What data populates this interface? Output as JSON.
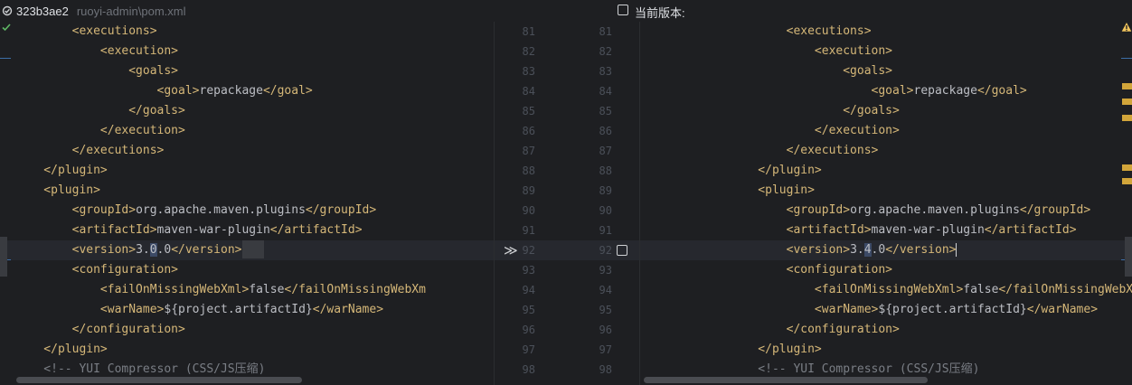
{
  "header": {
    "revision": "323b3ae2",
    "file_path": "ruoyi-admin\\pom.xml",
    "current_version_label": "当前版本:"
  },
  "icons": {
    "commit": "commit-check-icon",
    "status_ok": "checkmark-icon",
    "warning": "warning-icon",
    "apply_change": "apply-change-arrows-icon",
    "accept_checkbox": "checkbox-icon"
  },
  "colors": {
    "background": "#1e1f22",
    "tag": "#d5b778",
    "text": "#bcbec4",
    "comment": "#7a7e85",
    "changed_highlight": "#3c4a66",
    "marker": "#d2a53a"
  },
  "left_lines": [
    [
      [
        "tg",
        "        <executions>"
      ]
    ],
    [
      [
        "tg",
        "            <execution>"
      ]
    ],
    [
      [
        "tg",
        "                <goals>"
      ]
    ],
    [
      [
        "tg",
        "                    <goal>"
      ],
      [
        "tx",
        "repackage"
      ],
      [
        "tg",
        "</goal>"
      ]
    ],
    [
      [
        "tg",
        "                </goals>"
      ]
    ],
    [
      [
        "tg",
        "            </execution>"
      ]
    ],
    [
      [
        "tg",
        "        </executions>"
      ]
    ],
    [
      [
        "tg",
        "    </plugin>"
      ]
    ],
    [
      [
        "tg",
        "    <plugin>"
      ]
    ],
    [
      [
        "tg",
        "        <groupId>"
      ],
      [
        "tx",
        "org.apache.maven.plugins"
      ],
      [
        "tg",
        "</groupId>"
      ]
    ],
    [
      [
        "tg",
        "        <artifactId>"
      ],
      [
        "tx",
        "maven-war-plugin"
      ],
      [
        "tg",
        "</artifactId>"
      ]
    ],
    [
      [
        "tg",
        "        <version>"
      ],
      [
        "tx",
        "3."
      ],
      [
        "chg",
        "0"
      ],
      [
        "tx",
        ".0"
      ],
      [
        "tg",
        "</version>"
      ]
    ],
    [
      [
        "tg",
        "        <configuration>"
      ]
    ],
    [
      [
        "tg",
        "            <failOnMissingWebXml>"
      ],
      [
        "tx",
        "false"
      ],
      [
        "tg",
        "</failOnMissingWebXm"
      ]
    ],
    [
      [
        "tg",
        "            <warName>"
      ],
      [
        "tx",
        "${project.artifactId}"
      ],
      [
        "tg",
        "</warName>"
      ]
    ],
    [
      [
        "tg",
        "        </configuration>"
      ]
    ],
    [
      [
        "tg",
        "    </plugin>"
      ]
    ],
    [
      [
        "cm",
        "    <!-- YUI Compressor (CSS/JS压缩)"
      ]
    ]
  ],
  "right_lines": [
    [
      [
        "tg",
        "        <executions>"
      ]
    ],
    [
      [
        "tg",
        "            <execution>"
      ]
    ],
    [
      [
        "tg",
        "                <goals>"
      ]
    ],
    [
      [
        "tg",
        "                    <goal>"
      ],
      [
        "tx",
        "repackage"
      ],
      [
        "tg",
        "</goal>"
      ]
    ],
    [
      [
        "tg",
        "                </goals>"
      ]
    ],
    [
      [
        "tg",
        "            </execution>"
      ]
    ],
    [
      [
        "tg",
        "        </executions>"
      ]
    ],
    [
      [
        "tg",
        "    </plugin>"
      ]
    ],
    [
      [
        "tg",
        "    <plugin>"
      ]
    ],
    [
      [
        "tg",
        "        <groupId>"
      ],
      [
        "tx",
        "org.apache.maven.plugins"
      ],
      [
        "tg",
        "</groupId>"
      ]
    ],
    [
      [
        "tg",
        "        <artifactId>"
      ],
      [
        "tx",
        "maven-war-plugin"
      ],
      [
        "tg",
        "</artifactId>"
      ]
    ],
    [
      [
        "tg",
        "        <version>"
      ],
      [
        "tx",
        "3."
      ],
      [
        "chg",
        "4"
      ],
      [
        "tx",
        ".0"
      ],
      [
        "tg",
        "</version>"
      ]
    ],
    [
      [
        "tg",
        "        <configuration>"
      ]
    ],
    [
      [
        "tg",
        "            <failOnMissingWebXml>"
      ],
      [
        "tx",
        "false"
      ],
      [
        "tg",
        "</failOnMissingWebXml>"
      ]
    ],
    [
      [
        "tg",
        "            <warName>"
      ],
      [
        "tx",
        "${project.artifactId}"
      ],
      [
        "tg",
        "</warName>"
      ]
    ],
    [
      [
        "tg",
        "        </configuration>"
      ]
    ],
    [
      [
        "tg",
        "    </plugin>"
      ]
    ],
    [
      [
        "cm",
        "    <!-- YUI Compressor (CSS/JS压缩)"
      ]
    ]
  ],
  "line_numbers": {
    "left": [
      "81",
      "82",
      "83",
      "84",
      "85",
      "86",
      "87",
      "88",
      "89",
      "90",
      "91",
      "92",
      "93",
      "94",
      "95",
      "96",
      "97",
      "98"
    ],
    "right": [
      "81",
      "82",
      "83",
      "84",
      "85",
      "86",
      "87",
      "88",
      "89",
      "90",
      "91",
      "92",
      "93",
      "94",
      "95",
      "96",
      "97",
      "98"
    ]
  },
  "changed_line_index": 11,
  "apply_glyph": "≫"
}
